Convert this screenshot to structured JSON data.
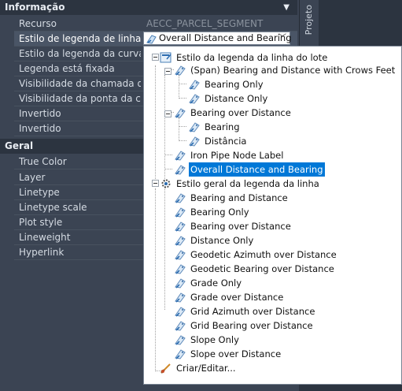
{
  "panel": {
    "side_tab_label": "Projeto",
    "sections": [
      {
        "title": "Informação",
        "rows": [
          {
            "label": "Recurso",
            "value": "AECC_PARCEL_SEGMENT"
          },
          {
            "label": "Estilo de legenda de linha",
            "value": ""
          },
          {
            "label": "Estilo da legenda da curva",
            "value": ""
          },
          {
            "label": "Legenda está fixada",
            "value": ""
          },
          {
            "label": "Visibilidade da chamada d...",
            "value": ""
          },
          {
            "label": "Visibilidade da ponta da ch...",
            "value": ""
          },
          {
            "label": "Invertido",
            "value": ""
          },
          {
            "label": "Invertido",
            "value": ""
          }
        ]
      },
      {
        "title": "Geral",
        "rows": [
          {
            "label": "True Color"
          },
          {
            "label": "Layer"
          },
          {
            "label": "Linetype"
          },
          {
            "label": "Linetype scale"
          },
          {
            "label": "Plot style"
          },
          {
            "label": "Lineweight"
          },
          {
            "label": "Hyperlink"
          }
        ]
      }
    ]
  },
  "combo": {
    "value": "Overall Distance and Bearing",
    "icon": "label-style-icon",
    "arrow": "chevron-down-icon"
  },
  "tree": {
    "root1": "Estilo da legenda da linha do lote",
    "span_group": "(Span)  Bearing and Distance with Crows Feet",
    "span_children": [
      "Bearing Only",
      "Distance Only"
    ],
    "bod_group": "Bearing over Distance",
    "bod_children": [
      "Bearing",
      "Distância"
    ],
    "iron_pipe": "Iron Pipe Node Label",
    "overall": "Overall Distance and Bearing",
    "root2": "Estilo geral da legenda da linha",
    "root2_children": [
      "Bearing and Distance",
      "Bearing Only",
      "Bearing over Distance",
      "Distance Only",
      "Geodetic Azimuth over Distance",
      "Geodetic Bearing over Distance",
      "Grade Only",
      "Grade over Distance",
      "Grid Azimuth over Distance",
      "Grid Bearing over Distance",
      "Slope Only",
      "Slope over Distance"
    ],
    "create_edit": "Criar/Editar..."
  },
  "colors": {
    "panel_bg": "#3b4453",
    "highlight": "#0078d7",
    "header_bg": "#2c3440"
  }
}
